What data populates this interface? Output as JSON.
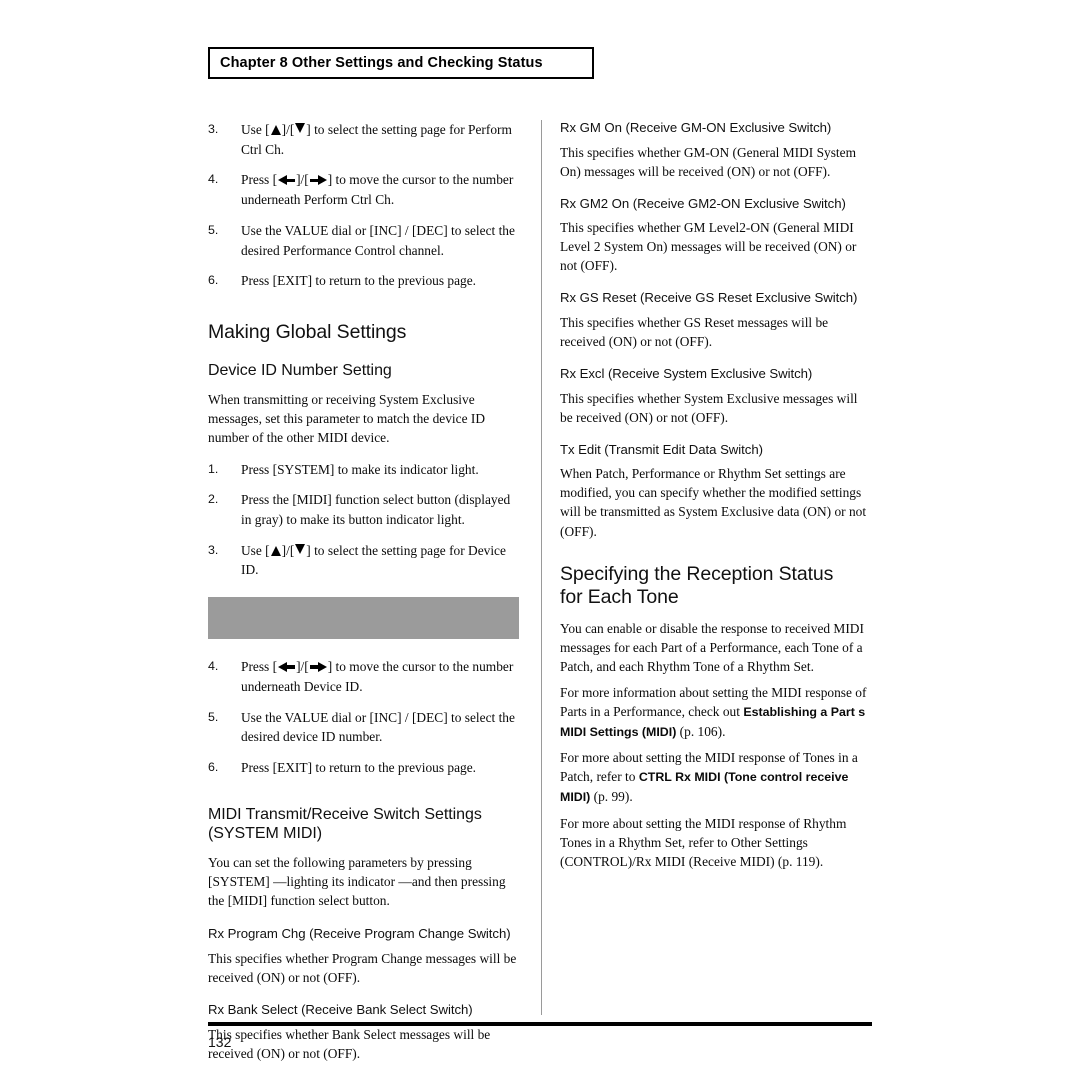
{
  "header": {
    "chapter_label": "Chapter 8 Other Settings and Checking Status"
  },
  "footer": {
    "page_number": "132",
    "rule_color": "#000000"
  },
  "figure": {
    "placeholder_color": "#9b9b9b"
  },
  "left_column": {
    "perform_ctrl_steps": [
      {
        "num": "3.",
        "pre": "Use [",
        "icon_a": "triangle-up-icon",
        "mid": "]/[",
        "icon_b": "triangle-down-icon",
        "post": "] to select the setting page for Perform Ctrl Ch."
      },
      {
        "num": "4.",
        "pre": "Press [",
        "icon_a": "arrow-left-icon",
        "mid": "]/[",
        "icon_b": "arrow-right-icon",
        "post": "] to move the cursor to the number underneath  Perform Ctrl Ch."
      },
      {
        "num": "5.",
        "text": "Use the VALUE dial or [INC] / [DEC] to select the desired Performance Control channel."
      },
      {
        "num": "6.",
        "text": "Press [EXIT] to return to the previous page."
      }
    ],
    "global_settings_heading": "Making Global Settings",
    "device_id_heading": "Device ID Number Setting",
    "device_id_intro": "When transmitting or receiving System Exclusive messages, set this parameter to match the device ID number of the other MIDI device.",
    "device_id_steps_a": [
      {
        "num": "1.",
        "text": "Press [SYSTEM] to make its indicator light."
      },
      {
        "num": "2.",
        "text": "Press the [MIDI] function select button (displayed in gray) to make its button indicator light."
      },
      {
        "num": "3.",
        "pre": "Use [",
        "icon_a": "triangle-up-icon",
        "mid": "]/[",
        "icon_b": "triangle-down-icon",
        "post": "] to select the setting page for Device ID."
      }
    ],
    "device_id_steps_b": [
      {
        "num": "4.",
        "pre": "Press [",
        "icon_a": "arrow-left-icon",
        "mid": "]/[",
        "icon_b": "arrow-right-icon",
        "post": "] to move the cursor to the number underneath  Device ID."
      },
      {
        "num": "5.",
        "text": "Use the VALUE dial or [INC] / [DEC] to select the desired device ID number."
      },
      {
        "num": "6.",
        "text": "Press [EXIT] to return to the previous page."
      }
    ],
    "midi_switch_heading_line1": "MIDI Transmit/Receive Switch Settings",
    "midi_switch_heading_line2": "(SYSTEM MIDI)",
    "midi_switch_intro": "You can set the following parameters by pressing [SYSTEM] —lighting its indicator —and then pressing the [MIDI] function select button.",
    "params": [
      {
        "title": "Rx Program Chg (Receive Program Change Switch)",
        "desc": "This specifies whether Program Change messages will be received (ON) or not (OFF)."
      },
      {
        "title": "Rx Bank Select (Receive Bank Select Switch)",
        "desc": "This specifies whether Bank Select messages will be received (ON) or not (OFF)."
      }
    ]
  },
  "right_column": {
    "params": [
      {
        "title": "Rx GM On (Receive GM-ON Exclusive Switch)",
        "desc": "This specifies whether GM-ON (General MIDI System On) messages will be received (ON) or not (OFF)."
      },
      {
        "title": "Rx GM2 On (Receive GM2-ON Exclusive Switch)",
        "desc": "This specifies whether GM Level2-ON (General MIDI Level 2 System On) messages will be received (ON) or not (OFF)."
      },
      {
        "title": "Rx GS Reset (Receive GS Reset Exclusive Switch)",
        "desc": "This specifies whether GS Reset messages will be received (ON) or not (OFF)."
      },
      {
        "title": "Rx Excl (Receive System Exclusive Switch)",
        "desc": "This specifies whether System Exclusive messages will be received (ON) or not (OFF)."
      },
      {
        "title": "Tx Edit (Transmit Edit Data Switch)",
        "desc": "When Patch, Performance or Rhythm Set settings are modified, you can specify whether the modified settings will be transmitted as System Exclusive data (ON) or not (OFF)."
      }
    ],
    "reception_heading_line1": "Specifying the Reception Status",
    "reception_heading_line2": "for Each Tone",
    "reception_intro": "You can enable or disable the response to received MIDI messages for each Part of a Performance, each Tone of a Patch, and each Rhythm Tone of a Rhythm Set.",
    "xref_parts_pre": "For more information about setting the MIDI response of Parts in a Performance, check out  ",
    "xref_parts_bold": "Establishing a Part s MIDI Settings (MIDI)",
    "xref_parts_post": " (p. 106).",
    "xref_tones_pre": "For more about setting the MIDI response of Tones in a Patch, refer to  ",
    "xref_tones_bold": "CTRL Rx MIDI (Tone control receive MIDI)",
    "xref_tones_post": " (p. 99).",
    "xref_rhythm": "For more about setting the MIDI response of Rhythm Tones in a Rhythm Set, refer to  Other Settings (CONTROL)/Rx MIDI (Receive MIDI)  (p. 119)."
  }
}
